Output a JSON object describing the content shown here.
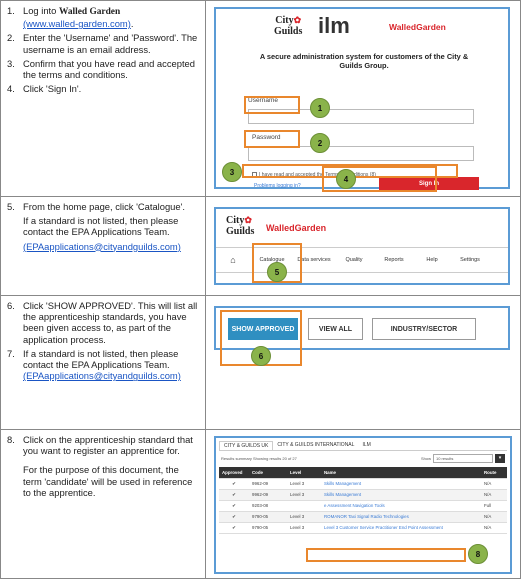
{
  "row1": {
    "steps": [
      {
        "n": "1.",
        "pre": "Log into ",
        "bold": "Walled Garden",
        "link": "(www.walled-garden.com)",
        "post": "."
      },
      {
        "n": "2.",
        "text": "Enter the 'Username' and 'Password'. The username is an email address."
      },
      {
        "n": "3.",
        "text": "Confirm that you have read and accepted the terms and conditions."
      },
      {
        "n": "4.",
        "text": "Click 'Sign In'."
      }
    ],
    "shot": {
      "brand_city": "City",
      "brand_guilds": "Guilds",
      "brand_ilm": "ilm",
      "brand_wg": "WalledGarden",
      "tagline": "A secure administration system for customers of the City & Guilds Group.",
      "username_label": "Username",
      "password_label": "Password",
      "terms_text": "I have read and accepted the Terms & Conditions (8)",
      "problems_text": "Problems logging in?",
      "signin_label": "Sign In",
      "markers": [
        "1",
        "2",
        "3",
        "4"
      ]
    }
  },
  "row2": {
    "steps": [
      {
        "n": "5.",
        "text": "From the home page, click 'Catalogue'."
      }
    ],
    "para": "If a standard is not listed, then please contact the EPA Applications Team.",
    "email": "(EPAapplications@cityandguilds.com)",
    "shot": {
      "brand_city": "City",
      "brand_guilds": "Guilds",
      "brand_wg": "WalledGarden",
      "nav": [
        "Catalogue",
        "Data services",
        "Quality",
        "Reports",
        "Help",
        "Settings"
      ],
      "marker": "5"
    }
  },
  "row3": {
    "steps": [
      {
        "n": "6.",
        "text": "Click 'SHOW APPROVED'. This will list all the apprenticeship standards, you have been given access to, as part of the application process."
      },
      {
        "n": "7.",
        "text": "If a standard is not listed, then please contact the EPA Applications Team."
      }
    ],
    "email": "(EPAapplications@cityandguilds.com)",
    "shot": {
      "buttons": [
        "SHOW APPROVED",
        "VIEW ALL",
        "INDUSTRY/SECTOR"
      ],
      "marker": "6"
    }
  },
  "row4": {
    "steps": [
      {
        "n": "8.",
        "text": "Click on the apprenticeship standard that you want to register an apprentice for."
      }
    ],
    "para": "For the purpose of this document, the term 'candidate' will be used in reference to the apprentice.",
    "shot": {
      "tabs": [
        "CITY & GUILDS UK",
        "CITY & GUILDS INTERNATIONAL",
        "ILM"
      ],
      "results": "Results summary",
      "showing": "Showing results 20 of 27",
      "show_label": "Show",
      "show_value": "10 results",
      "headers": [
        "Approved",
        "Code",
        "Level",
        "Name",
        "Route"
      ],
      "rows": [
        [
          "✔",
          "9962-09",
          "Level 3",
          "Skills Management",
          "N/A"
        ],
        [
          "✔",
          "9962-09",
          "Level 3",
          "Skills Management",
          "N/A"
        ],
        [
          "✔",
          "9203-08",
          "",
          "e Assessment Navigation Tools",
          "Full"
        ],
        [
          "✔",
          "9790-05",
          "Level 3",
          "ROMANOR Taxi Signal Radio Technologies",
          "N/A"
        ],
        [
          "✔",
          "9790-05",
          "Level 3",
          "Level 3 Customer Service Practitioner End Point Assessment",
          "N/A"
        ]
      ],
      "marker": "8"
    }
  }
}
